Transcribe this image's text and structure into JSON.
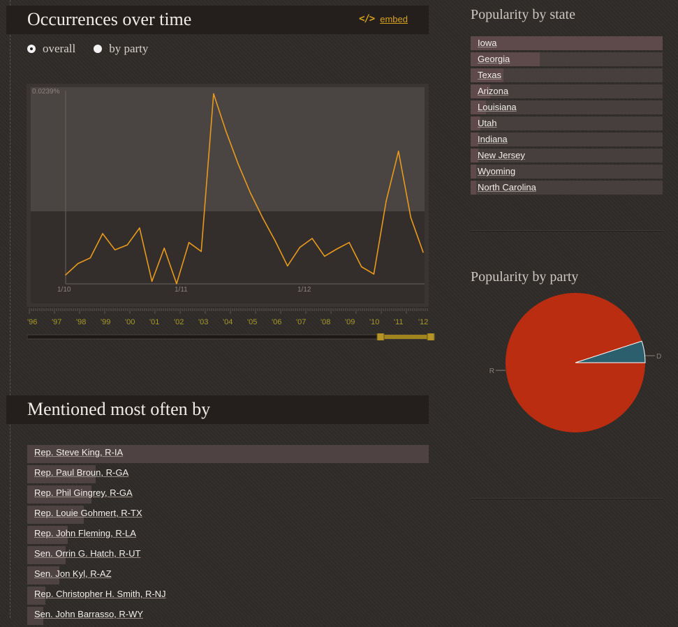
{
  "occurrences": {
    "title": "Occurrences over time",
    "embed_label": "embed",
    "modes": [
      {
        "label": "overall",
        "selected": true
      },
      {
        "label": "by party",
        "selected": false
      }
    ]
  },
  "chart_data": {
    "type": "line",
    "y_max_label": "0.0239%",
    "x_tick_labels": [
      "1/10",
      "1/11",
      "1/12"
    ],
    "y": [
      0.0012,
      0.0026,
      0.0033,
      0.0063,
      0.0043,
      0.0049,
      0.007,
      0.0004,
      0.0045,
      0.0001,
      0.0052,
      0.0041,
      0.0236,
      0.019,
      0.0149,
      0.0113,
      0.0082,
      0.0054,
      0.0023,
      0.0046,
      0.0057,
      0.0035,
      0.0044,
      0.0052,
      0.0022,
      0.0013,
      0.0103,
      0.0165,
      0.0083,
      0.004
    ],
    "ylim": [
      0,
      0.0239
    ],
    "color": "#e89a1c",
    "timeline_years": [
      "'96",
      "'97",
      "'98",
      "'99",
      "'00",
      "'01",
      "'02",
      "'03",
      "'04",
      "'05",
      "'06",
      "'07",
      "'08",
      "'09",
      "'10",
      "'11",
      "'12"
    ],
    "selection": {
      "start": "'10",
      "end": "'12"
    },
    "grid": false
  },
  "state": {
    "title": "Popularity by state",
    "items": [
      {
        "label": "Iowa",
        "share": 1.0
      },
      {
        "label": "Georgia",
        "share": 0.36
      },
      {
        "label": "Texas",
        "share": 0.17
      },
      {
        "label": "Arizona",
        "share": 0.1
      },
      {
        "label": "Louisiana",
        "share": 0.08
      },
      {
        "label": "Utah",
        "share": 0.05
      },
      {
        "label": "Indiana",
        "share": 0.04
      },
      {
        "label": "New Jersey",
        "share": 0.04
      },
      {
        "label": "Wyoming",
        "share": 0.03
      },
      {
        "label": "North Carolina",
        "share": 0.03
      }
    ]
  },
  "party": {
    "title": "Popularity by party",
    "slices": [
      {
        "label": "R",
        "value": 0.95,
        "color": "#bb2d10"
      },
      {
        "label": "D",
        "value": 0.05,
        "color": "#2b5f6e"
      }
    ]
  },
  "members": {
    "title": "Mentioned most often by",
    "items": [
      {
        "label": "Rep. Steve King, R-IA",
        "share": 1.0
      },
      {
        "label": "Rep. Paul Broun, R-GA",
        "share": 0.17
      },
      {
        "label": "Rep. Phil Gingrey, R-GA",
        "share": 0.16
      },
      {
        "label": "Rep. Louie Gohmert, R-TX",
        "share": 0.14
      },
      {
        "label": "Rep. John Fleming, R-LA",
        "share": 0.1
      },
      {
        "label": "Sen. Orrin G. Hatch, R-UT",
        "share": 0.095
      },
      {
        "label": "Sen. Jon Kyl, R-AZ",
        "share": 0.08
      },
      {
        "label": "Rep. Christopher H. Smith, R-NJ",
        "share": 0.045
      },
      {
        "label": "Sen. John Barrasso, R-WY",
        "share": 0.04
      }
    ]
  }
}
